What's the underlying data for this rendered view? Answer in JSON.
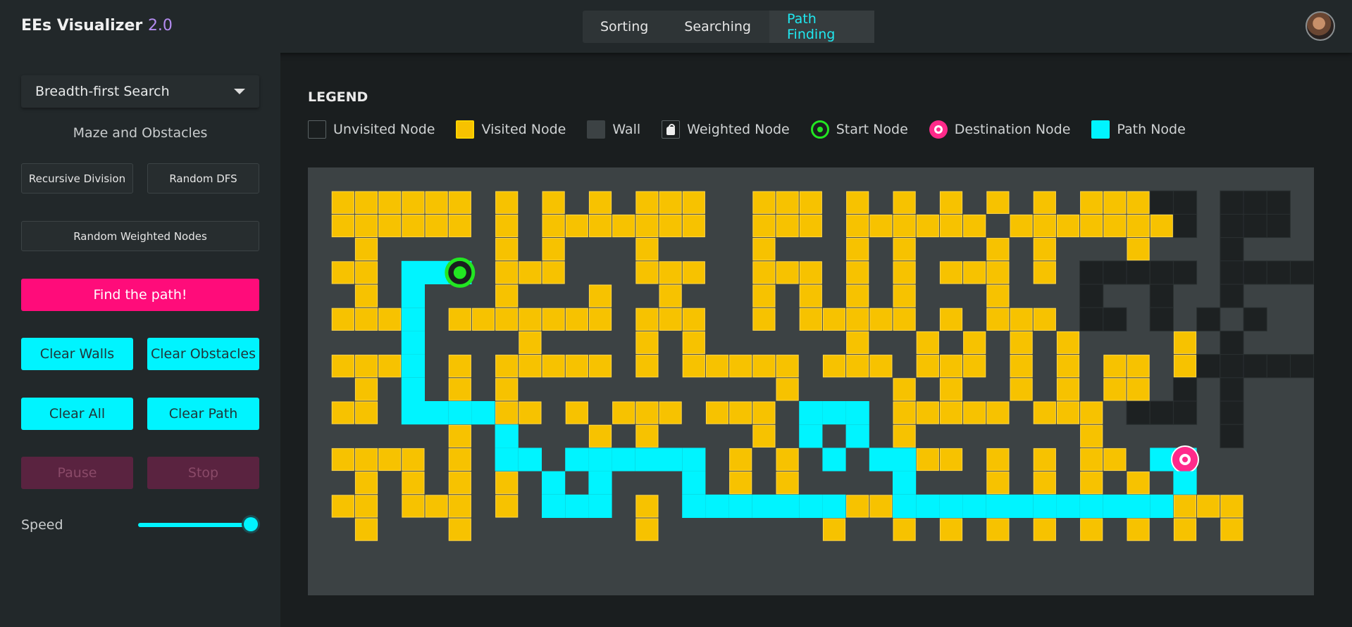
{
  "app": {
    "title": "EEs Visualizer",
    "version": "2.0"
  },
  "nav": {
    "tabs": [
      "Sorting",
      "Searching",
      "Path Finding"
    ],
    "active": "Path Finding"
  },
  "sidebar": {
    "algorithm": "Breadth-first Search",
    "maze_title": "Maze and Obstacles",
    "recursive_division": "Recursive Division",
    "random_dfs": "Random DFS",
    "random_weighted": "Random Weighted Nodes",
    "find_path": "Find the path!",
    "clear_walls": "Clear Walls",
    "clear_obstacles": "Clear Obstacles",
    "clear_all": "Clear All",
    "clear_path": "Clear Path",
    "pause": "Pause",
    "stop": "Stop",
    "speed_label": "Speed",
    "speed_value": 1.0
  },
  "legend": {
    "title": "LEGEND",
    "unvisited": "Unvisited Node",
    "visited": "Visited Node",
    "wall": "Wall",
    "weighted": "Weighted Node",
    "start": "Start Node",
    "destination": "Destination Node",
    "path": "Path Node"
  },
  "colors": {
    "accent": "#00f4ff",
    "pink": "#ff0c7a",
    "visited": "#f7c200",
    "wall": "#3c4244",
    "unvisited_black": "#1d2122",
    "start": "#22e622",
    "destination": "#ff2a8a"
  },
  "grid": {
    "cols": 42,
    "rows": 18,
    "cells": [
      "WWWWWWWWWWWWWWWWWWWWWWWWWWWWWWWWWWWWWWWWWW",
      "WVVVVVVWVWVWVWVVVWWVVVWVWVWVWVWVWVVVBBWBBBWW",
      "WVVVVVVWVWVVVVVVVWWVVVWVVVVVVWVVVVVVVBWBBBWW",
      "WWVWWWWWVWVWWWVWWWWVWWWVWVWWWVWVWWWVWWWBWWW",
      "WVVWPPSWVVVWWWVVVWWVVVWVWVWVVVWVWBBBBBWBBBBB",
      "WWVWPWWWVWWWVWWVWWWVWVWVWVWWWVWWWBWWBWWBWWW",
      "WVVVPWVVVVVVVWVVVWWVWVVVVVWVWVVVWBBWBWBWBWW",
      "WWWWPWWWWVWWWWVWVWWWWWWVWWVWVWVWVWWWWVWBWWW",
      "WVVVPWVWVVVVVWVWVVVVVWVVVWVVVWVWVWVVWVBBBBB",
      "WWVWPWVWVWWWWWWWWWWWVWWWWVWVWWVWVWVVWBWBWWW",
      "WVVWPPPPVVWVWVVVWVVVWPPPWVVVVVWVVVWBBBWBWWW",
      "WWWWWWVWPWWWVWVWWWWVWPWPWVWWWWWWWVWWWWWBWWW",
      "WVVVVWVWPPWPPPPPPWVWVWPWPPVVWVWVWVVWPDWWWW",
      "WWVWVWVWVWPWPWWWPWVWVWWWWPWWWVWVWVWVWPWWWWW",
      "WVVWVVVWVWPPPWVWPPPPPPPVVPPPPPPPPPPPPVVVWW",
      "WWVWWWVWWWWWWWVWWWWWWWVWWVWVWVWVWVWVWVWVWW",
      "WWWWWWWWWWWWWWWWWWWWWWWWWWWWWWWWWWWWWWWWWW"
    ]
  }
}
